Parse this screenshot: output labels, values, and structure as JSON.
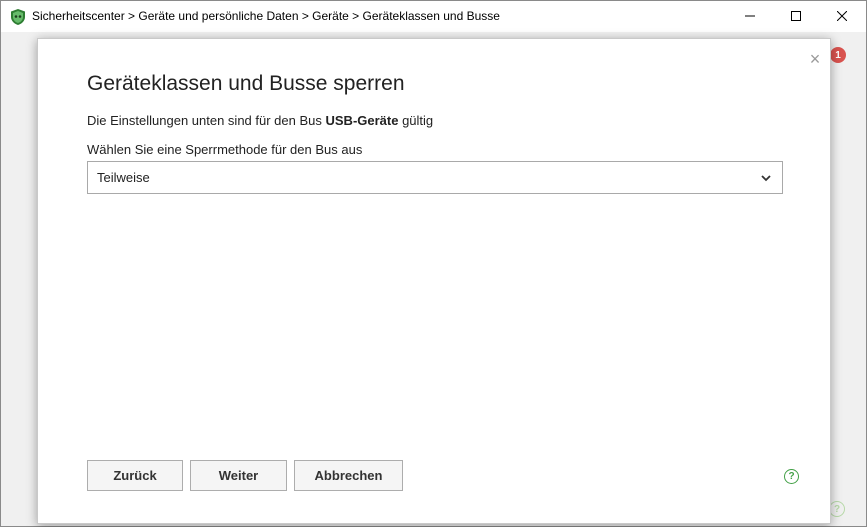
{
  "window": {
    "title": "Sicherheitscenter > Geräte und persönliche Daten > Geräte > Geräteklassen und Busse"
  },
  "background": {
    "notification_count": "1",
    "help_glyph": "?"
  },
  "dialog": {
    "title": "Geräteklassen und Busse sperren",
    "info_prefix": "Die Einstellungen unten sind für den Bus ",
    "info_bus": "USB-Geräte",
    "info_suffix": " gültig",
    "select_label": "Wählen Sie eine Sperrmethode für den Bus aus",
    "select_value": "Teilweise",
    "close_glyph": "×",
    "help_glyph": "?",
    "buttons": {
      "back": "Zurück",
      "next": "Weiter",
      "cancel": "Abbrechen"
    }
  },
  "colors": {
    "accent_green": "#43a047",
    "badge_red": "#d9534f"
  },
  "icons": {
    "app": "shield-app-icon",
    "minimize": "minimize-icon",
    "maximize": "maximize-icon",
    "close": "close-icon",
    "chevron": "chevron-down-icon",
    "help": "help-icon"
  }
}
